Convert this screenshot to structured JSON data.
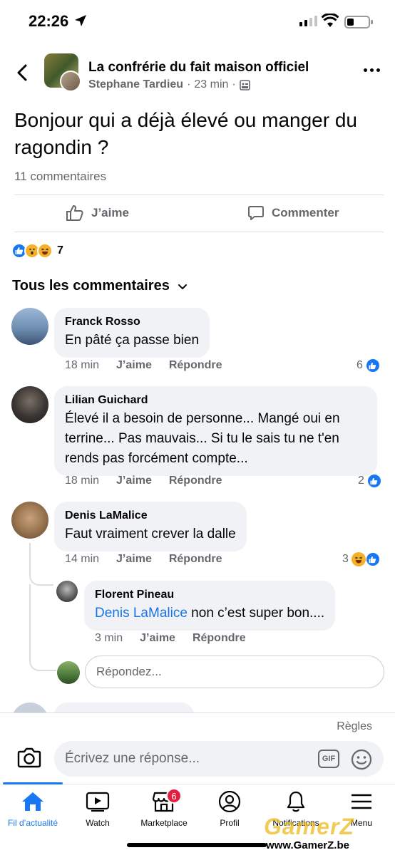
{
  "status_bar": {
    "time": "22:26"
  },
  "post": {
    "group_name": "La confrérie du fait maison officiel",
    "author": "Stephane Tardieu",
    "time": "23 min",
    "separator": "·",
    "text": "Bonjour qui a déjà élevé ou manger du ragondin ?",
    "comments_count": "11 commentaires",
    "like_label": "J’aime",
    "comment_label": "Commenter",
    "reactions_count": "7"
  },
  "comments_header": "Tous les commentaires",
  "comments": [
    {
      "name": "Franck Rosso",
      "text": "En pâté ça passe bien",
      "time": "18 min",
      "like": "J’aime",
      "reply": "Répondre",
      "reaction_count": "6"
    },
    {
      "name": "Lilian Guichard",
      "text": "Élevé il a besoin de personne... Mangé oui en terrine... Pas mauvais... Si tu le sais tu ne t'en rends pas forcément compte...",
      "time": "18 min",
      "like": "J’aime",
      "reply": "Répondre",
      "reaction_count": "2"
    },
    {
      "name": "Denis LaMalice",
      "text": "Faut vraiment crever la dalle",
      "time": "14 min",
      "like": "J’aime",
      "reply": "Répondre",
      "reaction_count": "3"
    }
  ],
  "reply": {
    "name": "Florent Pineau",
    "mention": "Denis LaMalice",
    "text": " non c’est super bon....",
    "time": "3 min",
    "like": "J’aime",
    "reply": "Répondre"
  },
  "reply_placeholder": "Répondez...",
  "composer": {
    "rules": "Règles",
    "placeholder": "Écrivez une réponse...",
    "gif": "GIF"
  },
  "tabs": [
    {
      "label": "Fil d’actualité",
      "icon": "home-icon"
    },
    {
      "label": "Watch",
      "icon": "watch-icon"
    },
    {
      "label": "Marketplace",
      "icon": "marketplace-icon",
      "badge": "6"
    },
    {
      "label": "Profil",
      "icon": "profile-icon"
    },
    {
      "label": "Notifications",
      "icon": "bell-icon"
    },
    {
      "label": "Menu",
      "icon": "menu-icon"
    }
  ],
  "watermark": {
    "brand": "GamerZ",
    "url": "www.GamerZ.be"
  },
  "colors": {
    "accent": "#1877f2",
    "secondary_text": "#65676b",
    "bubble": "#f0f2f5",
    "badge": "#e41e3f"
  }
}
